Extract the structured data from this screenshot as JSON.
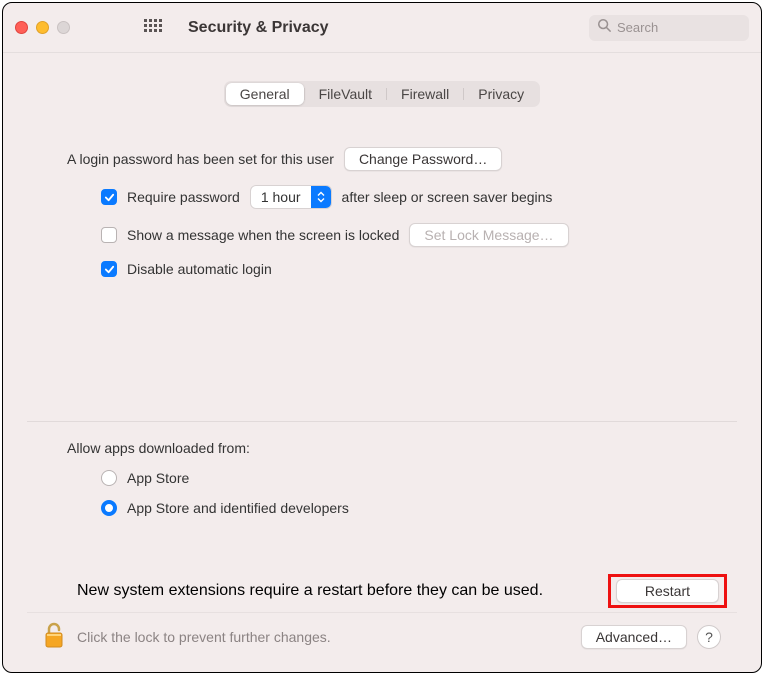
{
  "window": {
    "title": "Security & Privacy",
    "search_placeholder": "Search"
  },
  "tabs": [
    {
      "label": "General",
      "active": true
    },
    {
      "label": "FileVault",
      "active": false
    },
    {
      "label": "Firewall",
      "active": false
    },
    {
      "label": "Privacy",
      "active": false
    }
  ],
  "login": {
    "password_set_text": "A login password has been set for this user",
    "change_password_btn": "Change Password…",
    "require_password_label": "Require password",
    "require_password_checked": true,
    "delay_value": "1 hour",
    "delay_suffix": "after sleep or screen saver begins",
    "show_message_label": "Show a message when the screen is locked",
    "show_message_checked": false,
    "set_lock_message_btn": "Set Lock Message…",
    "disable_autologin_label": "Disable automatic login",
    "disable_autologin_checked": true
  },
  "allow_apps": {
    "title": "Allow apps downloaded from:",
    "options": [
      {
        "label": "App Store",
        "selected": false
      },
      {
        "label": "App Store and identified developers",
        "selected": true
      }
    ]
  },
  "extensions": {
    "message": "New system extensions require a restart before they can be used.",
    "restart_btn": "Restart"
  },
  "footer": {
    "lock_text": "Click the lock to prevent further changes.",
    "advanced_btn": "Advanced…",
    "help_label": "?"
  }
}
